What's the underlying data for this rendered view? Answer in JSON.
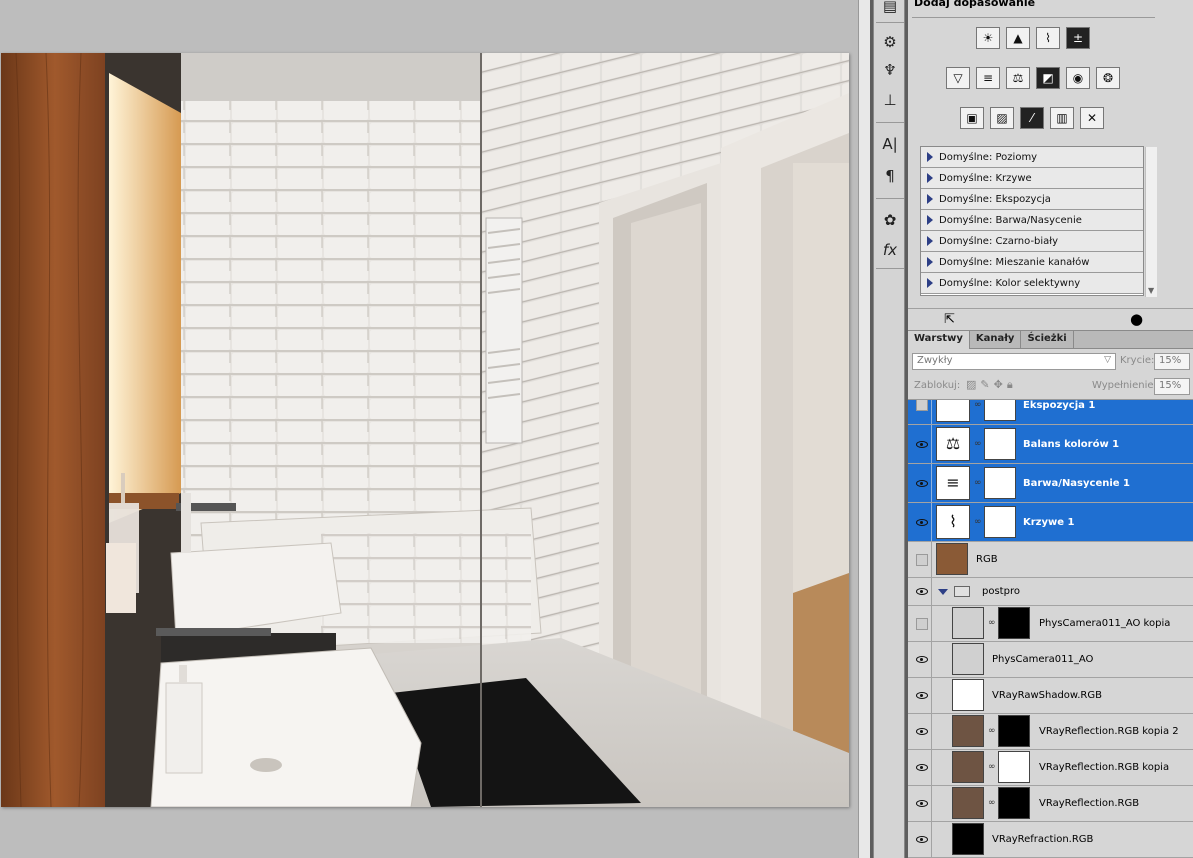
{
  "adjustments": {
    "title": "Dodaj dopasowanie",
    "presets": [
      "Domyślne: Poziomy",
      "Domyślne: Krzywe",
      "Domyślne: Ekspozycja",
      "Domyślne: Barwa/Nasycenie",
      "Domyślne: Czarno-biały",
      "Domyślne: Mieszanie kanałów",
      "Domyślne: Kolor selektywny"
    ]
  },
  "layers_panel": {
    "tabs": [
      "Warstwy",
      "Kanały",
      "Ścieżki"
    ],
    "blend_mode": "Zwykły",
    "opacity_label": "Krycie:",
    "opacity_value": "15%",
    "lock_label": "Zablokuj:",
    "fill_label": "Wypełnienie:",
    "fill_value": "15%",
    "layers": [
      {
        "name": "Ekspozycja 1",
        "selected": true,
        "visible": false
      },
      {
        "name": "Balans kolorów 1",
        "selected": true,
        "visible": true
      },
      {
        "name": "Barwa/Nasycenie 1",
        "selected": true,
        "visible": true
      },
      {
        "name": "Krzywe 1",
        "selected": true,
        "visible": true
      },
      {
        "name": "RGB",
        "selected": false,
        "visible": false
      },
      {
        "name": "postpro",
        "selected": false,
        "visible": true,
        "group": true
      },
      {
        "name": "PhysCamera011_AO kopia",
        "selected": false,
        "visible": false
      },
      {
        "name": "PhysCamera011_AO",
        "selected": false,
        "visible": true
      },
      {
        "name": "VRayRawShadow.RGB",
        "selected": false,
        "visible": true
      },
      {
        "name": "VRayReflection.RGB kopia 2",
        "selected": false,
        "visible": true
      },
      {
        "name": "VRayReflection.RGB kopia",
        "selected": false,
        "visible": true
      },
      {
        "name": "VRayReflection.RGB",
        "selected": false,
        "visible": true
      },
      {
        "name": "VRayRefraction.RGB",
        "selected": false,
        "visible": true
      }
    ]
  },
  "tool_icons": [
    "brush-presets-icon",
    "clone-source-icon",
    "stamp-icon",
    "character-icon",
    "paragraph-icon",
    "palette-icon",
    "fx-icon"
  ],
  "colors": {
    "selection": "#1f6fd1",
    "panel": "#d6d6d6"
  }
}
